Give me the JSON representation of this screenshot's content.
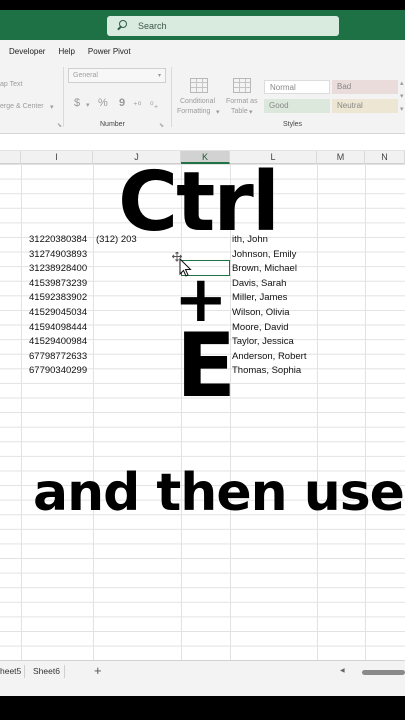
{
  "search": {
    "placeholder": "Search"
  },
  "menu": [
    "Developer",
    "Help",
    "Power Pivot"
  ],
  "ribbon": {
    "wrap_text": "ap Text",
    "merge_center": "erge & Center",
    "number_format": "General",
    "currency_symbol": "$",
    "percent_symbol": "%",
    "comma_symbol": "9",
    "conditional_formatting": [
      "Conditional",
      "Formatting"
    ],
    "format_as_table": [
      "Format as",
      "Table"
    ],
    "number_group": "Number",
    "styles_group": "Styles",
    "styles": {
      "normal": "Normal",
      "bad": "Bad",
      "good": "Good",
      "neutral": "Neutral"
    },
    "style_colors": {
      "normal": "#ffffff",
      "bad": "#ffc7ce",
      "good": "#c6efce",
      "neutral": "#ffeb9c"
    }
  },
  "columns": [
    "I",
    "J",
    "K",
    "L",
    "M",
    "N"
  ],
  "selected_column": "K",
  "rows": [
    {
      "i": "31220380384",
      "j": "(312) 203",
      "l": "ith, John"
    },
    {
      "i": "31274903893",
      "j": "",
      "l": "Johnson, Emily"
    },
    {
      "i": "31238928400",
      "j": "",
      "l": "Brown, Michael"
    },
    {
      "i": "41539873239",
      "j": "",
      "l": "Davis, Sarah"
    },
    {
      "i": "41592383902",
      "j": "",
      "l": "Miller, James"
    },
    {
      "i": "41529045034",
      "j": "",
      "l": "Wilson, Olivia"
    },
    {
      "i": "41594098444",
      "j": "",
      "l": "Moore, David"
    },
    {
      "i": "41529400984",
      "j": "",
      "l": "Taylor, Jessica"
    },
    {
      "i": "67798772633",
      "j": "",
      "l": "Anderson, Robert"
    },
    {
      "i": "67790340299",
      "j": "",
      "l": "Thomas, Sophia"
    }
  ],
  "overlay": {
    "line1": "Ctrl",
    "line2": "+",
    "line3": "E",
    "line4": "and then use"
  },
  "sheets": [
    "heet5",
    "Sheet6"
  ],
  "colors": {
    "title_bar": "#1e7145",
    "accent": "#217346"
  }
}
